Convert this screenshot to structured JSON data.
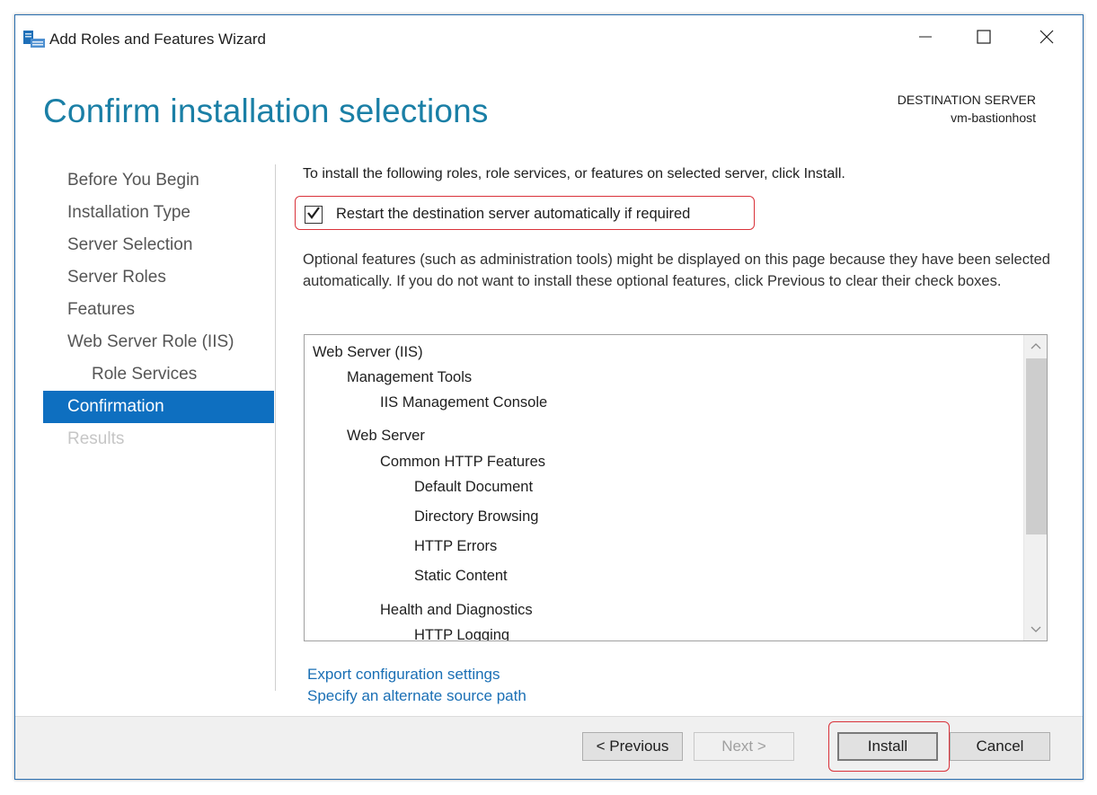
{
  "window": {
    "title": "Add Roles and Features Wizard",
    "icons": {
      "app": "server-manager-icon",
      "minimize": "minimize-icon",
      "maximize": "maximize-icon",
      "close": "close-icon"
    }
  },
  "header": {
    "page_title": "Confirm installation selections",
    "destination_label": "DESTINATION SERVER",
    "destination_value": "vm-bastionhost"
  },
  "nav": {
    "items": [
      {
        "label": "Before You Begin",
        "state": "normal"
      },
      {
        "label": "Installation Type",
        "state": "normal"
      },
      {
        "label": "Server Selection",
        "state": "normal"
      },
      {
        "label": "Server Roles",
        "state": "normal"
      },
      {
        "label": "Features",
        "state": "normal"
      },
      {
        "label": "Web Server Role (IIS)",
        "state": "normal"
      },
      {
        "label": "Role Services",
        "state": "sub"
      },
      {
        "label": "Confirmation",
        "state": "active"
      },
      {
        "label": "Results",
        "state": "disabled"
      }
    ]
  },
  "content": {
    "intro": "To install the following roles, role services, or features on selected server, click Install.",
    "restart_checkbox": {
      "label": "Restart the destination server automatically if required",
      "checked": true
    },
    "optional_note": "Optional features (such as administration tools) might be displayed on this page because they have been selected automatically. If you do not want to install these optional features, click Previous to clear their check boxes.",
    "features": [
      {
        "label": "Web Server (IIS)",
        "level": 0
      },
      {
        "label": "Management Tools",
        "level": 1
      },
      {
        "label": "IIS Management Console",
        "level": 2
      },
      {
        "label": "Web Server",
        "level": 1
      },
      {
        "label": "Common HTTP Features",
        "level": 2
      },
      {
        "label": "Default Document",
        "level": 3
      },
      {
        "label": "Directory Browsing",
        "level": 3
      },
      {
        "label": "HTTP Errors",
        "level": 3
      },
      {
        "label": "Static Content",
        "level": 3
      },
      {
        "label": "Health and Diagnostics",
        "level": 2
      },
      {
        "label": "HTTP Logging",
        "level": 3
      }
    ],
    "links": {
      "export": "Export configuration settings",
      "alternate_source": "Specify an alternate source path"
    }
  },
  "footer": {
    "previous_label": "< Previous",
    "next_label": "Next >",
    "install_label": "Install",
    "cancel_label": "Cancel"
  },
  "colors": {
    "title_accent": "#1a7fa6",
    "nav_active_bg": "#0e6fc0",
    "link": "#1a6fb5",
    "highlight": "#d9323a"
  }
}
